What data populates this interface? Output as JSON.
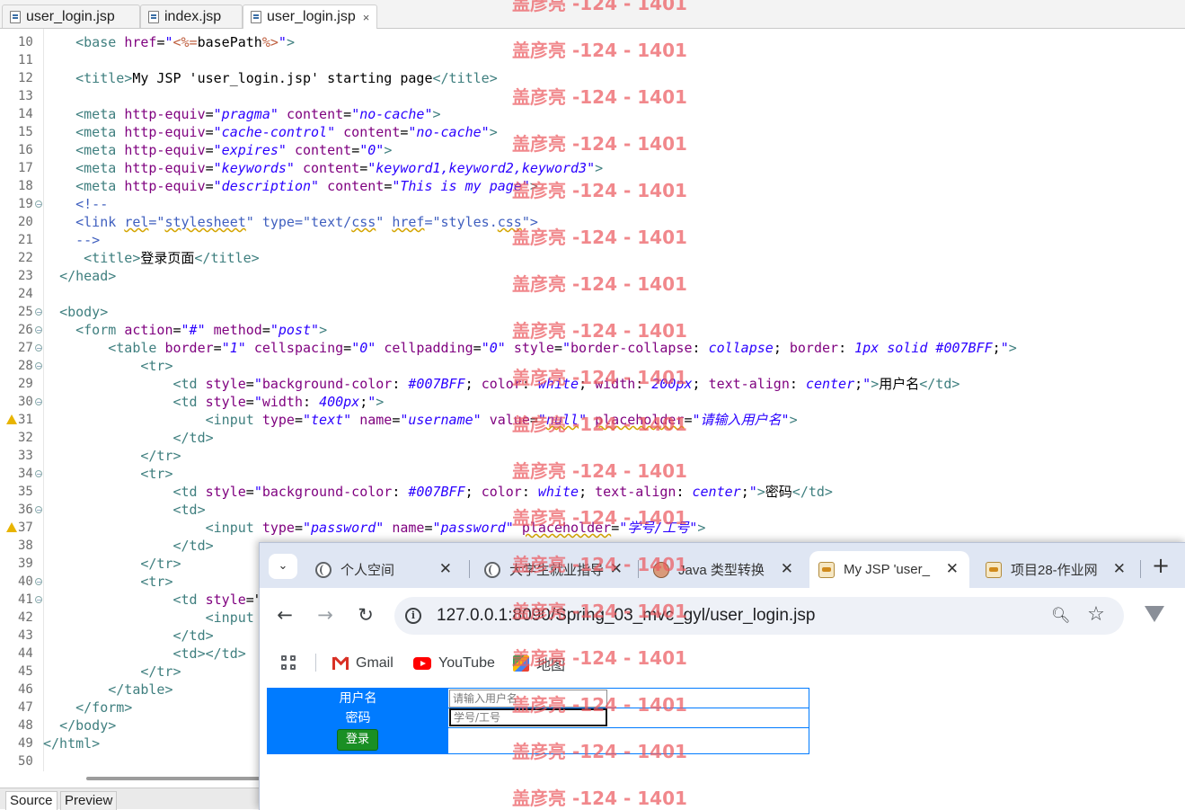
{
  "editor": {
    "tabs": [
      {
        "label": "user_login.jsp",
        "close": ""
      },
      {
        "label": "index.jsp",
        "close": ""
      },
      {
        "label": "user_login.jsp",
        "close": "×"
      }
    ],
    "bottom_tabs": {
      "source": "Source",
      "preview": "Preview"
    },
    "lines": [
      {
        "n": "10",
        "html": "    <span class='t'>&lt;base</span> <span class='a'>href</span>=<span class='v2'>\"</span><span class='j'>&lt;%=</span>basePath<span class='j'>%&gt;</span><span class='v2'>\"</span><span class='t'>&gt;</span>"
      },
      {
        "n": "11",
        "html": ""
      },
      {
        "n": "12",
        "html": "    <span class='t'>&lt;title&gt;</span>My JSP 'user_login.jsp' starting page<span class='t'>&lt;/title&gt;</span>"
      },
      {
        "n": "13",
        "html": ""
      },
      {
        "n": "14",
        "html": "    <span class='t'>&lt;meta</span> <span class='a'>http-equiv</span>=<span class='v'>\"pragma\"</span> <span class='a'>content</span>=<span class='v'>\"no-cache\"</span><span class='t'>&gt;</span>"
      },
      {
        "n": "15",
        "html": "    <span class='t'>&lt;meta</span> <span class='a'>http-equiv</span>=<span class='v'>\"cache-control\"</span> <span class='a'>content</span>=<span class='v'>\"no-cache\"</span><span class='t'>&gt;</span>"
      },
      {
        "n": "16",
        "html": "    <span class='t'>&lt;meta</span> <span class='a'>http-equiv</span>=<span class='v'>\"expires\"</span> <span class='a'>content</span>=<span class='v'>\"0\"</span><span class='t'>&gt;</span>"
      },
      {
        "n": "17",
        "html": "    <span class='t'>&lt;meta</span> <span class='a'>http-equiv</span>=<span class='v'>\"keywords\"</span> <span class='a'>content</span>=<span class='v'>\"keyword1,keyword2,keyword3\"</span><span class='t'>&gt;</span>"
      },
      {
        "n": "18",
        "html": "    <span class='t'>&lt;meta</span> <span class='a'>http-equiv</span>=<span class='v'>\"description\"</span> <span class='a'>content</span>=<span class='v'>\"This is my page\"</span><span class='t'>&gt;</span>"
      },
      {
        "n": "19",
        "fold": true,
        "html": "    <span class='c'>&lt;!--</span>"
      },
      {
        "n": "20",
        "html": "    <span class='c'>&lt;link <span class='sq'>rel</span>=\"<span class='sq'>stylesheet</span>\" type=\"text/<span class='sq'>css</span>\" <span class='sq'>href</span>=\"styles.<span class='sq'>css</span>\"&gt;</span>"
      },
      {
        "n": "21",
        "html": "    <span class='c'>--&gt;</span>"
      },
      {
        "n": "22",
        "html": "     <span class='t'>&lt;title&gt;</span>登录页面<span class='t'>&lt;/title&gt;</span>"
      },
      {
        "n": "23",
        "html": "  <span class='t'>&lt;/head&gt;</span>"
      },
      {
        "n": "24",
        "html": ""
      },
      {
        "n": "25",
        "fold": true,
        "html": "  <span class='t'>&lt;body&gt;</span>"
      },
      {
        "n": "26",
        "fold": true,
        "html": "    <span class='t'>&lt;form</span> <span class='a'>action</span>=<span class='v'>\"#\"</span> <span class='a'>method</span>=<span class='v'>\"post\"</span><span class='t'>&gt;</span>"
      },
      {
        "n": "27",
        "fold": true,
        "html": "        <span class='t'>&lt;table</span> <span class='a'>border</span>=<span class='v'>\"1\"</span> <span class='a'>cellspacing</span>=<span class='v'>\"0\"</span> <span class='a'>cellpadding</span>=<span class='v'>\"0\"</span> <span class='a'>style</span>=<span class='v2'>\"</span><span class='a'>border-collapse</span>: <span class='v'>collapse</span>; <span class='a'>border</span>: <span class='v'>1px solid #007BFF</span>;<span class='v2'>\"</span><span class='t'>&gt;</span>"
      },
      {
        "n": "28",
        "fold": true,
        "html": "            <span class='t'>&lt;tr&gt;</span>"
      },
      {
        "n": "29",
        "html": "                <span class='t'>&lt;td</span> <span class='a'>style</span>=<span class='v2'>\"</span><span class='a'>background-color</span>: <span class='v'>#007BFF</span>; <span class='a'>color</span>: <span class='v'>white</span>; <span class='a'>width</span>: <span class='v'>200px</span>; <span class='a'>text-align</span>: <span class='v'>center</span>;<span class='v2'>\"</span><span class='t'>&gt;</span>用户名<span class='t'>&lt;/td&gt;</span>"
      },
      {
        "n": "30",
        "fold": true,
        "html": "                <span class='t'>&lt;td</span> <span class='a'>style</span>=<span class='v2'>\"</span><span class='a'>width</span>: <span class='v'>400px</span>;<span class='v2'>\"</span><span class='t'>&gt;</span>"
      },
      {
        "n": "31",
        "warn": true,
        "html": "                    <span class='t'>&lt;input</span> <span class='a'>type</span>=<span class='v'>\"text\"</span> <span class='a'>name</span>=<span class='v'>\"username\"</span> <span class='a'>value</span>=<span class='v'>\"<span class='sq'>null</span>\"</span> <span class='a sq'>placeholder</span>=<span class='v'>\"请输入用户名\"</span><span class='t'>&gt;</span>"
      },
      {
        "n": "32",
        "html": "                <span class='t'>&lt;/td&gt;</span>"
      },
      {
        "n": "33",
        "html": "            <span class='t'>&lt;/tr&gt;</span>"
      },
      {
        "n": "34",
        "fold": true,
        "html": "            <span class='t'>&lt;tr&gt;</span>"
      },
      {
        "n": "35",
        "html": "                <span class='t'>&lt;td</span> <span class='a'>style</span>=<span class='v2'>\"</span><span class='a'>background-color</span>: <span class='v'>#007BFF</span>; <span class='a'>color</span>: <span class='v'>white</span>; <span class='a'>text-align</span>: <span class='v'>center</span>;<span class='v2'>\"</span><span class='t'>&gt;</span>密码<span class='t'>&lt;/td&gt;</span>"
      },
      {
        "n": "36",
        "fold": true,
        "html": "                <span class='t'>&lt;td&gt;</span>"
      },
      {
        "n": "37",
        "warn": true,
        "html": "                    <span class='t'>&lt;input</span> <span class='a'>type</span>=<span class='v'>\"password\"</span> <span class='a'>name</span>=<span class='v'>\"password\"</span> <span class='a sq'>placeholder</span>=<span class='v'>\"学号/工号\"</span><span class='t'>&gt;</span>"
      },
      {
        "n": "38",
        "html": "                <span class='t'>&lt;/td&gt;</span>"
      },
      {
        "n": "39",
        "html": "            <span class='t'>&lt;/tr&gt;</span>"
      },
      {
        "n": "40",
        "fold": true,
        "html": "            <span class='t'>&lt;tr&gt;</span>"
      },
      {
        "n": "41",
        "fold": true,
        "html": "                <span class='t'>&lt;td</span> <span class='a'>style</span>=\""
      },
      {
        "n": "42",
        "html": "                    <span class='t'>&lt;input</span>"
      },
      {
        "n": "43",
        "html": "                <span class='t'>&lt;/td&gt;</span>"
      },
      {
        "n": "44",
        "html": "                <span class='t'>&lt;td&gt;&lt;/td&gt;</span>"
      },
      {
        "n": "45",
        "html": "            <span class='t'>&lt;/tr&gt;</span>"
      },
      {
        "n": "46",
        "html": "        <span class='t'>&lt;/table&gt;</span>"
      },
      {
        "n": "47",
        "html": "    <span class='t'>&lt;/form&gt;</span>"
      },
      {
        "n": "48",
        "html": "  <span class='t'>&lt;/body&gt;</span>"
      },
      {
        "n": "49",
        "html": "<span class='t'>&lt;/html&gt;</span>"
      },
      {
        "n": "50",
        "html": ""
      }
    ]
  },
  "browser": {
    "tabs": [
      {
        "label": "个人空间",
        "icon": "globe-icon"
      },
      {
        "label": "大学生就业指导",
        "icon": "globe-icon"
      },
      {
        "label": "Java 类型转换",
        "icon": "avatar-icon"
      },
      {
        "label": "My JSP 'user_",
        "icon": "tomcat-icon",
        "active": true
      },
      {
        "label": "项目28-作业网",
        "icon": "tomcat-icon"
      }
    ],
    "tab_search_icon": "⌄",
    "new_tab": "+",
    "url": "127.0.0.1:8090/Spring_03_mvc_gyl/user_login.jsp",
    "bookmarks": [
      {
        "label": "Gmail",
        "icon": "gmail-icon"
      },
      {
        "label": "YouTube",
        "icon": "youtube-icon"
      },
      {
        "label": "地图",
        "icon": "maps-icon"
      }
    ],
    "page": {
      "username_label": "用户名",
      "password_label": "密码",
      "username_placeholder": "请输入用户名",
      "password_placeholder": "学号/工号",
      "login_button": "登录",
      "brand_color": "#007BFF"
    }
  },
  "watermark": {
    "text": "盖彦亮 -124 - 1401"
  }
}
